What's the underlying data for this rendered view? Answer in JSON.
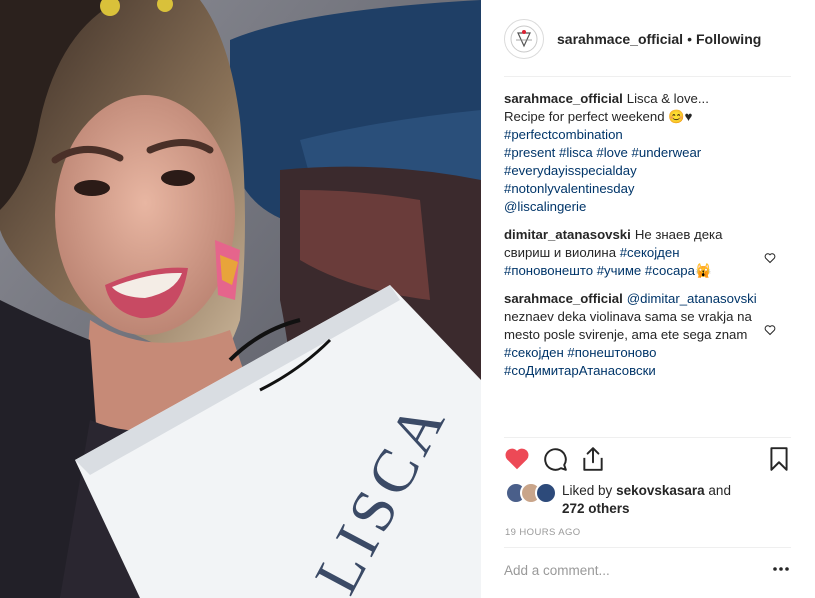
{
  "header": {
    "username": "sarahmace_official",
    "separator": "•",
    "follow_status": "Following"
  },
  "comments": [
    {
      "user": "sarahmace_official",
      "text": "Lisca & love...",
      "line2": "Recipe for perfect weekend 😊♥",
      "tags": [
        "#perfectcombination",
        "#present #lisca #love #underwear",
        "#everydayisspecialday #notonlyvalentinesday",
        "@liscalingerie"
      ]
    },
    {
      "user": "dimitar_atanasovski",
      "text": "Не знаев дека",
      "line2": "свириш и виолина",
      "tag_inline": "#секојден",
      "line3": "#поновонешто #учиме #сосара🙀"
    },
    {
      "user": "sarahmace_official",
      "mention": "@dimitar_atanasovski",
      "line2": "neznaev deka violinava sama se vrakja na",
      "line3": "mesto posle svirenje, ama ete sega znam",
      "tags": [
        "#секојден #понештоново",
        "#соДимитарАтанасовски"
      ]
    }
  ],
  "likes": {
    "prefix": "Liked by",
    "user": "sekovskasara",
    "suffix": "and",
    "others": "272 others"
  },
  "timestamp": "19 HOURS AGO",
  "add_comment_placeholder": "Add a comment...",
  "colors": {
    "like_red": "#ed4956",
    "link_blue": "#003569",
    "muted": "#999999"
  },
  "icons": {
    "like": "heart-filled-icon",
    "comment": "comment-bubble-icon",
    "share": "share-icon",
    "save": "bookmark-icon",
    "more": "more-options-icon"
  }
}
